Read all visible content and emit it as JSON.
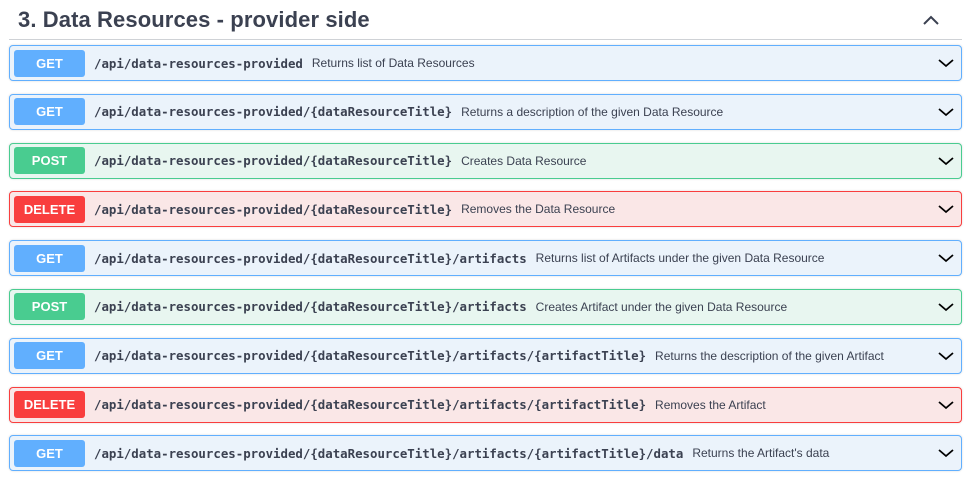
{
  "section": {
    "title": "3. Data Resources - provider side",
    "collapse_icon": "chevron-up-icon"
  },
  "operations": [
    {
      "method": "GET",
      "path": "/api/data-resources-provided",
      "summary": "Returns list of Data Resources"
    },
    {
      "method": "GET",
      "path": "/api/data-resources-provided/{dataResourceTitle}",
      "summary": "Returns a description of the given Data Resource"
    },
    {
      "method": "POST",
      "path": "/api/data-resources-provided/{dataResourceTitle}",
      "summary": "Creates Data Resource"
    },
    {
      "method": "DELETE",
      "path": "/api/data-resources-provided/{dataResourceTitle}",
      "summary": "Removes the Data Resource"
    },
    {
      "method": "GET",
      "path": "/api/data-resources-provided/{dataResourceTitle}/artifacts",
      "summary": "Returns list of Artifacts under the given Data Resource"
    },
    {
      "method": "POST",
      "path": "/api/data-resources-provided/{dataResourceTitle}/artifacts",
      "summary": "Creates Artifact under the given Data Resource"
    },
    {
      "method": "GET",
      "path": "/api/data-resources-provided/{dataResourceTitle}/artifacts/{artifactTitle}",
      "summary": "Returns the description of the given Artifact"
    },
    {
      "method": "DELETE",
      "path": "/api/data-resources-provided/{dataResourceTitle}/artifacts/{artifactTitle}",
      "summary": "Removes the Artifact"
    },
    {
      "method": "GET",
      "path": "/api/data-resources-provided/{dataResourceTitle}/artifacts/{artifactTitle}/data",
      "summary": "Returns the Artifact's data"
    }
  ],
  "colors": {
    "get": "#61affe",
    "post": "#49cc90",
    "delete": "#f93e3e",
    "text": "#3b4151"
  }
}
